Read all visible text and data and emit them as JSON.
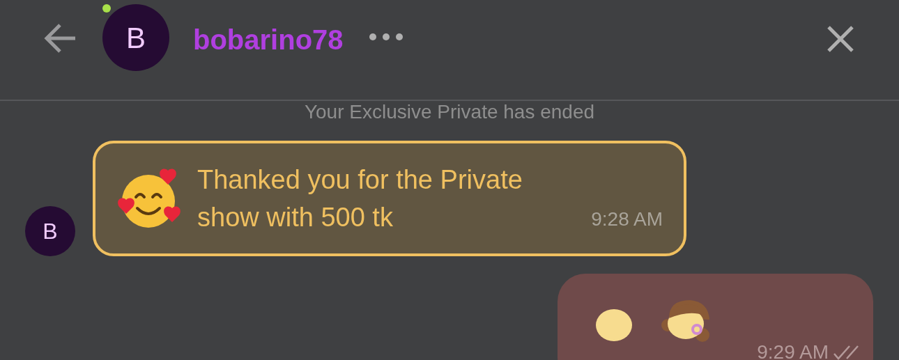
{
  "header": {
    "avatar_letter": "B",
    "online": true,
    "name": "bobarino78"
  },
  "system_message": "Your Exclusive Private has ended",
  "messages": [
    {
      "kind": "tip",
      "avatar_letter": "B",
      "text": "Thanked you for the Private show with 500 tk",
      "time": "9:28 AM"
    },
    {
      "kind": "emoji",
      "time": "9:29 AM",
      "read": true
    }
  ]
}
